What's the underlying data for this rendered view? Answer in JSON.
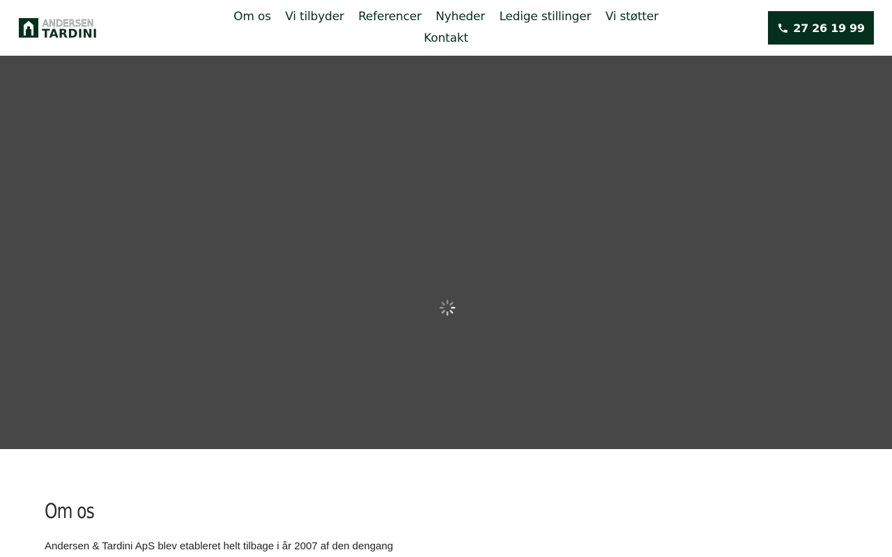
{
  "logo": {
    "top_text": "ANDERSEN",
    "bottom_text": "TARDINI"
  },
  "nav": {
    "items": [
      {
        "label": "Om os"
      },
      {
        "label": "Vi tilbyder"
      },
      {
        "label": "Referencer"
      },
      {
        "label": "Nyheder"
      },
      {
        "label": "Ledige stillinger"
      },
      {
        "label": "Vi støtter"
      },
      {
        "label": "Kontakt"
      }
    ]
  },
  "phone": {
    "label": "27 26 19 99",
    "icon": "phone-icon"
  },
  "hero": {
    "state": "loading",
    "icon": "spinner-icon"
  },
  "about": {
    "heading": "Om os",
    "paragraph": "Andersen & Tardini ApS blev etableret helt tilbage i år 2007 af den dengang"
  },
  "colors": {
    "brand_dark_green": "#05301f",
    "nav_text": "#062c1f",
    "hero_bg": "#474747",
    "white": "#ffffff"
  }
}
